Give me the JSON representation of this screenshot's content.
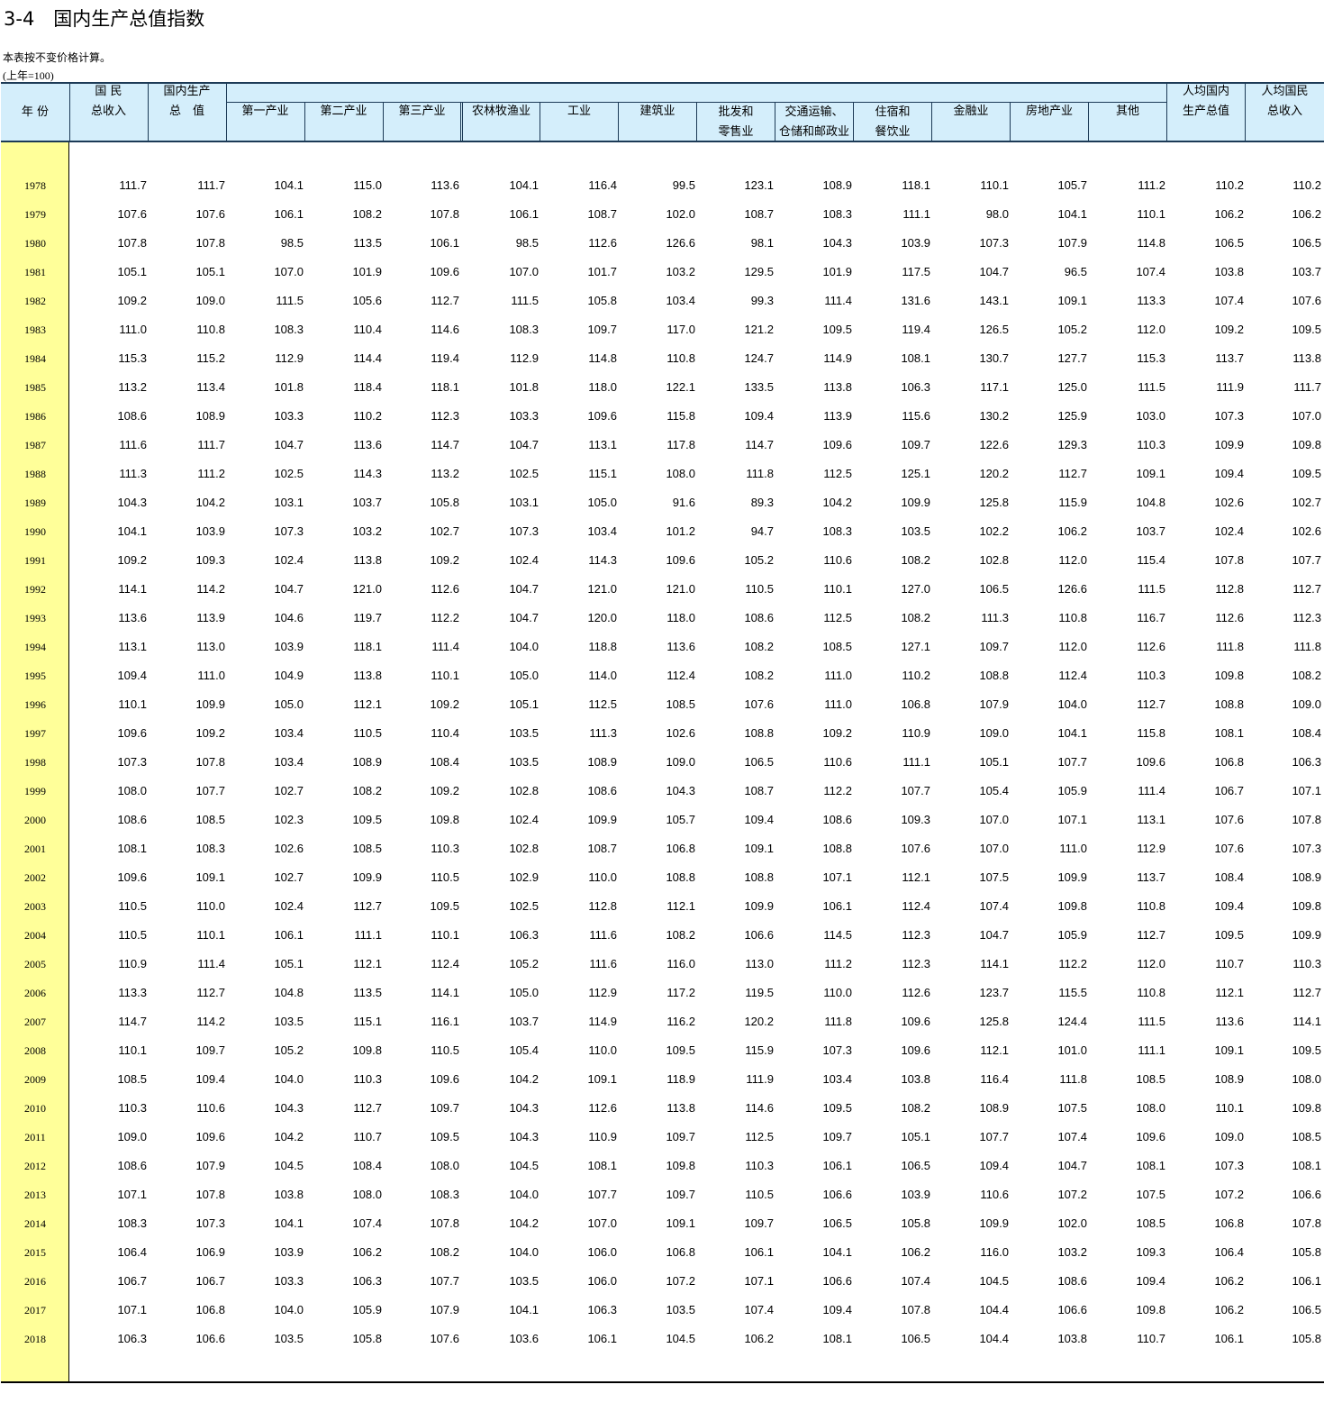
{
  "title": "3-4　国内生产总值指数",
  "note": "本表按不变价格计算。",
  "unit": "(上年=100)",
  "headers": {
    "year": "年 份",
    "gni": [
      "国 民",
      "总收入"
    ],
    "gdp": [
      "国内生产",
      "总　值"
    ],
    "primary": "第一产业",
    "secondary": "第二产业",
    "tertiary": "第三产业",
    "agri": "农林牧渔业",
    "industry": "工业",
    "construction": "建筑业",
    "trade": [
      "批发和",
      "零售业"
    ],
    "transport": [
      "交通运输、",
      "仓储和邮政业"
    ],
    "hotel": [
      "住宿和",
      "餐饮业"
    ],
    "finance": "金融业",
    "realestate": "房地产业",
    "other": "其他",
    "gdp_pc": [
      "人均国内",
      "生产总值"
    ],
    "gni_pc": [
      "人均国民",
      "总收入"
    ]
  },
  "rows": [
    {
      "year": "1978",
      "v": [
        "111.7",
        "111.7",
        "104.1",
        "115.0",
        "113.6",
        "104.1",
        "116.4",
        "99.5",
        "123.1",
        "108.9",
        "118.1",
        "110.1",
        "105.7",
        "111.2",
        "110.2",
        "110.2"
      ]
    },
    {
      "year": "1979",
      "v": [
        "107.6",
        "107.6",
        "106.1",
        "108.2",
        "107.8",
        "106.1",
        "108.7",
        "102.0",
        "108.7",
        "108.3",
        "111.1",
        "98.0",
        "104.1",
        "110.1",
        "106.2",
        "106.2"
      ]
    },
    {
      "year": "1980",
      "v": [
        "107.8",
        "107.8",
        "98.5",
        "113.5",
        "106.1",
        "98.5",
        "112.6",
        "126.6",
        "98.1",
        "104.3",
        "103.9",
        "107.3",
        "107.9",
        "114.8",
        "106.5",
        "106.5"
      ]
    },
    {
      "year": "1981",
      "v": [
        "105.1",
        "105.1",
        "107.0",
        "101.9",
        "109.6",
        "107.0",
        "101.7",
        "103.2",
        "129.5",
        "101.9",
        "117.5",
        "104.7",
        "96.5",
        "107.4",
        "103.8",
        "103.7"
      ]
    },
    {
      "year": "1982",
      "v": [
        "109.2",
        "109.0",
        "111.5",
        "105.6",
        "112.7",
        "111.5",
        "105.8",
        "103.4",
        "99.3",
        "111.4",
        "131.6",
        "143.1",
        "109.1",
        "113.3",
        "107.4",
        "107.6"
      ]
    },
    {
      "year": "1983",
      "v": [
        "111.0",
        "110.8",
        "108.3",
        "110.4",
        "114.6",
        "108.3",
        "109.7",
        "117.0",
        "121.2",
        "109.5",
        "119.4",
        "126.5",
        "105.2",
        "112.0",
        "109.2",
        "109.5"
      ]
    },
    {
      "year": "1984",
      "v": [
        "115.3",
        "115.2",
        "112.9",
        "114.4",
        "119.4",
        "112.9",
        "114.8",
        "110.8",
        "124.7",
        "114.9",
        "108.1",
        "130.7",
        "127.7",
        "115.3",
        "113.7",
        "113.8"
      ]
    },
    {
      "year": "1985",
      "v": [
        "113.2",
        "113.4",
        "101.8",
        "118.4",
        "118.1",
        "101.8",
        "118.0",
        "122.1",
        "133.5",
        "113.8",
        "106.3",
        "117.1",
        "125.0",
        "111.5",
        "111.9",
        "111.7"
      ]
    },
    {
      "year": "1986",
      "v": [
        "108.6",
        "108.9",
        "103.3",
        "110.2",
        "112.3",
        "103.3",
        "109.6",
        "115.8",
        "109.4",
        "113.9",
        "115.6",
        "130.2",
        "125.9",
        "103.0",
        "107.3",
        "107.0"
      ]
    },
    {
      "year": "1987",
      "v": [
        "111.6",
        "111.7",
        "104.7",
        "113.6",
        "114.7",
        "104.7",
        "113.1",
        "117.8",
        "114.7",
        "109.6",
        "109.7",
        "122.6",
        "129.3",
        "110.3",
        "109.9",
        "109.8"
      ]
    },
    {
      "year": "1988",
      "v": [
        "111.3",
        "111.2",
        "102.5",
        "114.3",
        "113.2",
        "102.5",
        "115.1",
        "108.0",
        "111.8",
        "112.5",
        "125.1",
        "120.2",
        "112.7",
        "109.1",
        "109.4",
        "109.5"
      ]
    },
    {
      "year": "1989",
      "v": [
        "104.3",
        "104.2",
        "103.1",
        "103.7",
        "105.8",
        "103.1",
        "105.0",
        "91.6",
        "89.3",
        "104.2",
        "109.9",
        "125.8",
        "115.9",
        "104.8",
        "102.6",
        "102.7"
      ]
    },
    {
      "year": "1990",
      "v": [
        "104.1",
        "103.9",
        "107.3",
        "103.2",
        "102.7",
        "107.3",
        "103.4",
        "101.2",
        "94.7",
        "108.3",
        "103.5",
        "102.2",
        "106.2",
        "103.7",
        "102.4",
        "102.6"
      ]
    },
    {
      "year": "1991",
      "v": [
        "109.2",
        "109.3",
        "102.4",
        "113.8",
        "109.2",
        "102.4",
        "114.3",
        "109.6",
        "105.2",
        "110.6",
        "108.2",
        "102.8",
        "112.0",
        "115.4",
        "107.8",
        "107.7"
      ]
    },
    {
      "year": "1992",
      "v": [
        "114.1",
        "114.2",
        "104.7",
        "121.0",
        "112.6",
        "104.7",
        "121.0",
        "121.0",
        "110.5",
        "110.1",
        "127.0",
        "106.5",
        "126.6",
        "111.5",
        "112.8",
        "112.7"
      ]
    },
    {
      "year": "1993",
      "v": [
        "113.6",
        "113.9",
        "104.6",
        "119.7",
        "112.2",
        "104.7",
        "120.0",
        "118.0",
        "108.6",
        "112.5",
        "108.2",
        "111.3",
        "110.8",
        "116.7",
        "112.6",
        "112.3"
      ]
    },
    {
      "year": "1994",
      "v": [
        "113.1",
        "113.0",
        "103.9",
        "118.1",
        "111.4",
        "104.0",
        "118.8",
        "113.6",
        "108.2",
        "108.5",
        "127.1",
        "109.7",
        "112.0",
        "112.6",
        "111.8",
        "111.8"
      ]
    },
    {
      "year": "1995",
      "v": [
        "109.4",
        "111.0",
        "104.9",
        "113.8",
        "110.1",
        "105.0",
        "114.0",
        "112.4",
        "108.2",
        "111.0",
        "110.2",
        "108.8",
        "112.4",
        "110.3",
        "109.8",
        "108.2"
      ]
    },
    {
      "year": "1996",
      "v": [
        "110.1",
        "109.9",
        "105.0",
        "112.1",
        "109.2",
        "105.1",
        "112.5",
        "108.5",
        "107.6",
        "111.0",
        "106.8",
        "107.9",
        "104.0",
        "112.7",
        "108.8",
        "109.0"
      ]
    },
    {
      "year": "1997",
      "v": [
        "109.6",
        "109.2",
        "103.4",
        "110.5",
        "110.4",
        "103.5",
        "111.3",
        "102.6",
        "108.8",
        "109.2",
        "110.9",
        "109.0",
        "104.1",
        "115.8",
        "108.1",
        "108.4"
      ]
    },
    {
      "year": "1998",
      "v": [
        "107.3",
        "107.8",
        "103.4",
        "108.9",
        "108.4",
        "103.5",
        "108.9",
        "109.0",
        "106.5",
        "110.6",
        "111.1",
        "105.1",
        "107.7",
        "109.6",
        "106.8",
        "106.3"
      ]
    },
    {
      "year": "1999",
      "v": [
        "108.0",
        "107.7",
        "102.7",
        "108.2",
        "109.2",
        "102.8",
        "108.6",
        "104.3",
        "108.7",
        "112.2",
        "107.7",
        "105.4",
        "105.9",
        "111.4",
        "106.7",
        "107.1"
      ]
    },
    {
      "year": "2000",
      "v": [
        "108.6",
        "108.5",
        "102.3",
        "109.5",
        "109.8",
        "102.4",
        "109.9",
        "105.7",
        "109.4",
        "108.6",
        "109.3",
        "107.0",
        "107.1",
        "113.1",
        "107.6",
        "107.8"
      ]
    },
    {
      "year": "2001",
      "v": [
        "108.1",
        "108.3",
        "102.6",
        "108.5",
        "110.3",
        "102.8",
        "108.7",
        "106.8",
        "109.1",
        "108.8",
        "107.6",
        "107.0",
        "111.0",
        "112.9",
        "107.6",
        "107.3"
      ]
    },
    {
      "year": "2002",
      "v": [
        "109.6",
        "109.1",
        "102.7",
        "109.9",
        "110.5",
        "102.9",
        "110.0",
        "108.8",
        "108.8",
        "107.1",
        "112.1",
        "107.5",
        "109.9",
        "113.7",
        "108.4",
        "108.9"
      ]
    },
    {
      "year": "2003",
      "v": [
        "110.5",
        "110.0",
        "102.4",
        "112.7",
        "109.5",
        "102.5",
        "112.8",
        "112.1",
        "109.9",
        "106.1",
        "112.4",
        "107.4",
        "109.8",
        "110.8",
        "109.4",
        "109.8"
      ]
    },
    {
      "year": "2004",
      "v": [
        "110.5",
        "110.1",
        "106.1",
        "111.1",
        "110.1",
        "106.3",
        "111.6",
        "108.2",
        "106.6",
        "114.5",
        "112.3",
        "104.7",
        "105.9",
        "112.7",
        "109.5",
        "109.9"
      ]
    },
    {
      "year": "2005",
      "v": [
        "110.9",
        "111.4",
        "105.1",
        "112.1",
        "112.4",
        "105.2",
        "111.6",
        "116.0",
        "113.0",
        "111.2",
        "112.3",
        "114.1",
        "112.2",
        "112.0",
        "110.7",
        "110.3"
      ]
    },
    {
      "year": "2006",
      "v": [
        "113.3",
        "112.7",
        "104.8",
        "113.5",
        "114.1",
        "105.0",
        "112.9",
        "117.2",
        "119.5",
        "110.0",
        "112.6",
        "123.7",
        "115.5",
        "110.8",
        "112.1",
        "112.7"
      ]
    },
    {
      "year": "2007",
      "v": [
        "114.7",
        "114.2",
        "103.5",
        "115.1",
        "116.1",
        "103.7",
        "114.9",
        "116.2",
        "120.2",
        "111.8",
        "109.6",
        "125.8",
        "124.4",
        "111.5",
        "113.6",
        "114.1"
      ]
    },
    {
      "year": "2008",
      "v": [
        "110.1",
        "109.7",
        "105.2",
        "109.8",
        "110.5",
        "105.4",
        "110.0",
        "109.5",
        "115.9",
        "107.3",
        "109.6",
        "112.1",
        "101.0",
        "111.1",
        "109.1",
        "109.5"
      ]
    },
    {
      "year": "2009",
      "v": [
        "108.5",
        "109.4",
        "104.0",
        "110.3",
        "109.6",
        "104.2",
        "109.1",
        "118.9",
        "111.9",
        "103.4",
        "103.8",
        "116.4",
        "111.8",
        "108.5",
        "108.9",
        "108.0"
      ]
    },
    {
      "year": "2010",
      "v": [
        "110.3",
        "110.6",
        "104.3",
        "112.7",
        "109.7",
        "104.3",
        "112.6",
        "113.8",
        "114.6",
        "109.5",
        "108.2",
        "108.9",
        "107.5",
        "108.0",
        "110.1",
        "109.8"
      ]
    },
    {
      "year": "2011",
      "v": [
        "109.0",
        "109.6",
        "104.2",
        "110.7",
        "109.5",
        "104.3",
        "110.9",
        "109.7",
        "112.5",
        "109.7",
        "105.1",
        "107.7",
        "107.4",
        "109.6",
        "109.0",
        "108.5"
      ]
    },
    {
      "year": "2012",
      "v": [
        "108.6",
        "107.9",
        "104.5",
        "108.4",
        "108.0",
        "104.5",
        "108.1",
        "109.8",
        "110.3",
        "106.1",
        "106.5",
        "109.4",
        "104.7",
        "108.1",
        "107.3",
        "108.1"
      ]
    },
    {
      "year": "2013",
      "v": [
        "107.1",
        "107.8",
        "103.8",
        "108.0",
        "108.3",
        "104.0",
        "107.7",
        "109.7",
        "110.5",
        "106.6",
        "103.9",
        "110.6",
        "107.2",
        "107.5",
        "107.2",
        "106.6"
      ]
    },
    {
      "year": "2014",
      "v": [
        "108.3",
        "107.3",
        "104.1",
        "107.4",
        "107.8",
        "104.2",
        "107.0",
        "109.1",
        "109.7",
        "106.5",
        "105.8",
        "109.9",
        "102.0",
        "108.5",
        "106.8",
        "107.8"
      ]
    },
    {
      "year": "2015",
      "v": [
        "106.4",
        "106.9",
        "103.9",
        "106.2",
        "108.2",
        "104.0",
        "106.0",
        "106.8",
        "106.1",
        "104.1",
        "106.2",
        "116.0",
        "103.2",
        "109.3",
        "106.4",
        "105.8"
      ]
    },
    {
      "year": "2016",
      "v": [
        "106.7",
        "106.7",
        "103.3",
        "106.3",
        "107.7",
        "103.5",
        "106.0",
        "107.2",
        "107.1",
        "106.6",
        "107.4",
        "104.5",
        "108.6",
        "109.4",
        "106.2",
        "106.1"
      ]
    },
    {
      "year": "2017",
      "v": [
        "107.1",
        "106.8",
        "104.0",
        "105.9",
        "107.9",
        "104.1",
        "106.3",
        "103.5",
        "107.4",
        "109.4",
        "107.8",
        "104.4",
        "106.6",
        "109.8",
        "106.2",
        "106.5"
      ]
    },
    {
      "year": "2018",
      "v": [
        "106.3",
        "106.6",
        "103.5",
        "105.8",
        "107.6",
        "103.6",
        "106.1",
        "104.5",
        "106.2",
        "108.1",
        "106.5",
        "104.4",
        "103.8",
        "110.7",
        "106.1",
        "105.8"
      ]
    }
  ]
}
